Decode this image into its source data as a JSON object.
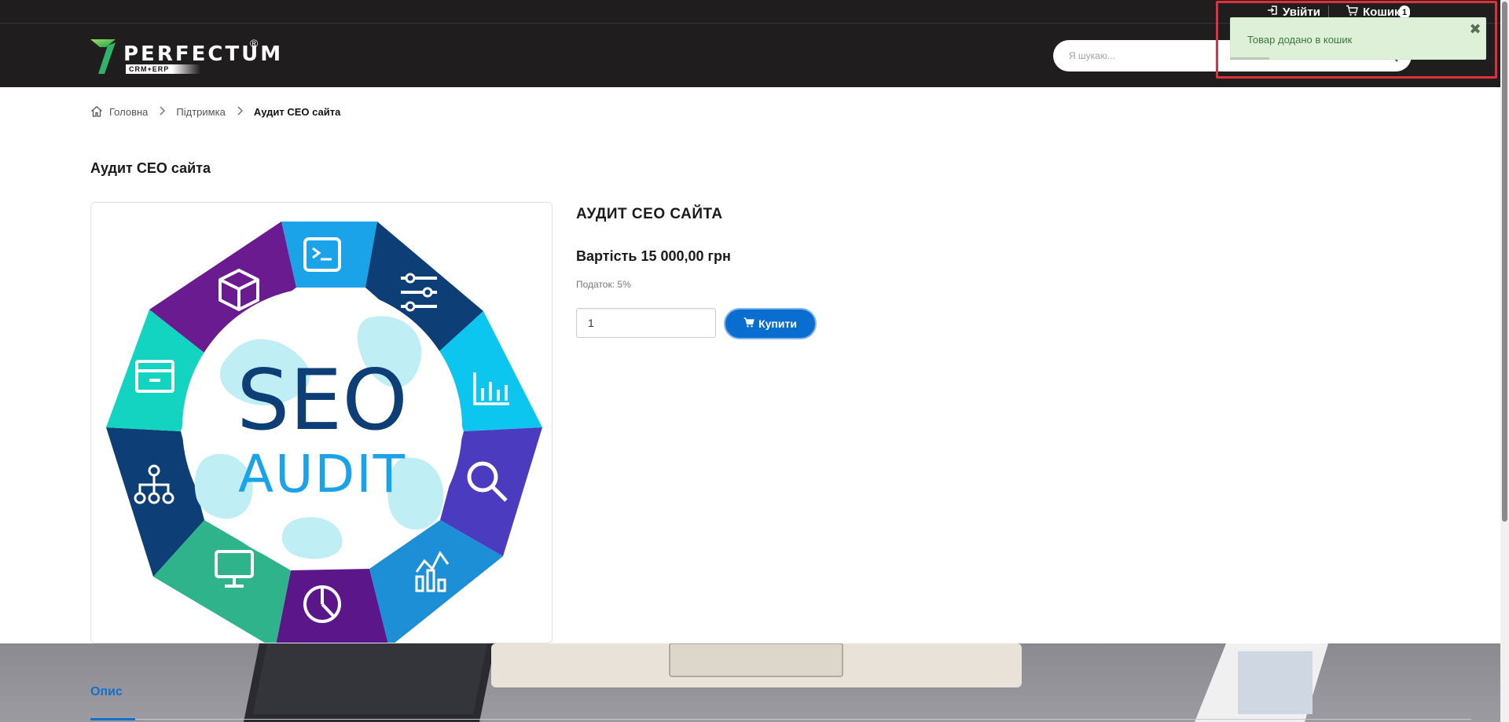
{
  "topbar": {
    "login_label": "Увійти",
    "cart_label": "Кошик",
    "cart_count": "1"
  },
  "header": {
    "logo_text": "PERFECTUM",
    "logo_reg": "®",
    "logo_sub": "CRM+ERP",
    "search_placeholder": "Я шукаю..."
  },
  "toast": {
    "message": "Товар додано в кошик",
    "close_glyph": "✖"
  },
  "breadcrumb": {
    "items": [
      "Головна",
      "Підтримка"
    ],
    "current": "Аудит СЕО сайта"
  },
  "page_title": "Аудит СЕО сайта",
  "product": {
    "name": "АУДИТ СЕО САЙТА",
    "price": "Вартість 15 000,00 грн",
    "tax": "Податок: 5%",
    "quantity": "1",
    "buy_label": "Купити",
    "image": {
      "title_line1": "SEO",
      "title_line2": "AUDIT"
    }
  },
  "tabs": {
    "active": "Опис"
  },
  "colors": {
    "header_bg": "#1f1d1d",
    "accent_blue": "#0a6ed1",
    "toast_bg": "#dff0d8",
    "toast_text": "#3c763d",
    "highlight_frame": "#e0303a"
  }
}
